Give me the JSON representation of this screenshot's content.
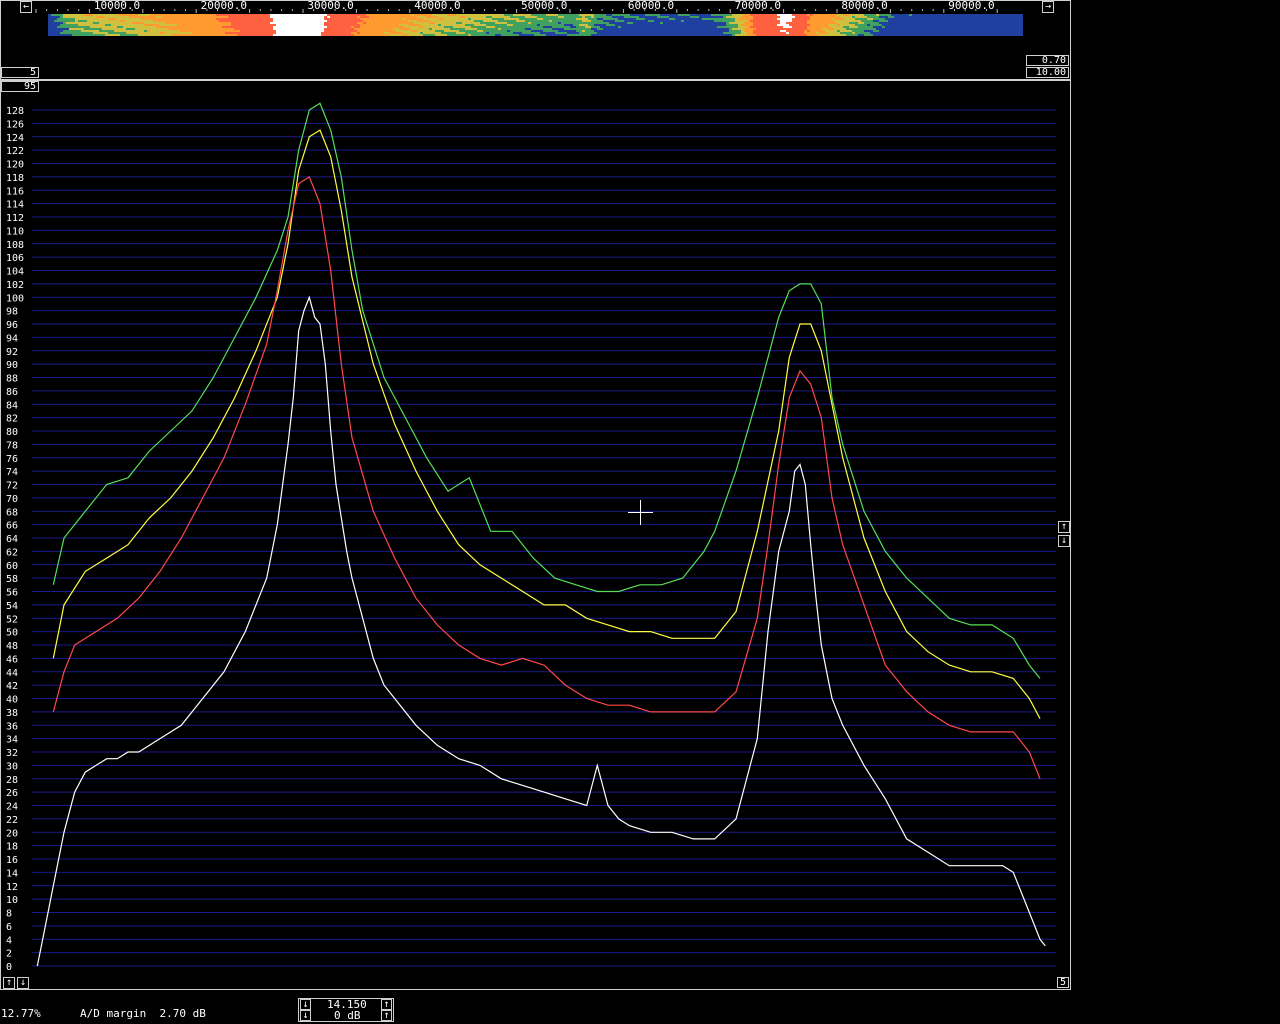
{
  "freq_axis": {
    "labels": [
      "10000.0",
      "20000.0",
      "30000.0",
      "40000.0",
      "50000.0",
      "60000.0",
      "70000.0",
      "80000.0",
      "90000.0"
    ]
  },
  "left_boxes": {
    "box_a": "5",
    "box_b": "95"
  },
  "right_boxes": {
    "box_a": "0.70",
    "box_b": "10.00"
  },
  "bottom_right_box": "5",
  "y_axis": {
    "min": 0,
    "max": 128,
    "step": 2,
    "labels": [
      "128",
      "126",
      "124",
      "122",
      "120",
      "118",
      "116",
      "114",
      "112",
      "110",
      "108",
      "106",
      "104",
      "102",
      "100",
      "98",
      "96",
      "94",
      "92",
      "90",
      "88",
      "86",
      "84",
      "82",
      "80",
      "78",
      "76",
      "74",
      "72",
      "70",
      "68",
      "66",
      "64",
      "62",
      "60",
      "58",
      "56",
      "54",
      "52",
      "50",
      "48",
      "46",
      "44",
      "42",
      "40",
      "38",
      "36",
      "34",
      "32",
      "30",
      "28",
      "26",
      "24",
      "22",
      "20",
      "18",
      "16",
      "14",
      "12",
      "10",
      "8",
      "6",
      "4",
      "2",
      "0"
    ]
  },
  "colors": {
    "grid": "#1a1a8c",
    "trace_white": "#ffffff",
    "trace_red": "#ff4a4a",
    "trace_yellow": "#ffff40",
    "trace_green": "#55e055",
    "frame": "#cfcfcf"
  },
  "chart_data": {
    "type": "line",
    "xlabel": "",
    "ylabel": "",
    "xlim": [
      0,
      96000
    ],
    "ylim": [
      0,
      128
    ],
    "series": [
      {
        "color": "green",
        "x": [
          2000,
          3000,
          5000,
          7000,
          9000,
          11000,
          13000,
          15000,
          17000,
          19000,
          21000,
          23000,
          24000,
          25000,
          26000,
          27000,
          28000,
          29000,
          30000,
          31000,
          33000,
          35000,
          37000,
          39000,
          41000,
          43000,
          45000,
          47000,
          49000,
          51000,
          53000,
          55000,
          57000,
          59000,
          61000,
          63000,
          64000,
          66000,
          68000,
          70000,
          71000,
          72000,
          73000,
          74000,
          75000,
          76000,
          77000,
          78000,
          80000,
          82000,
          84000,
          86000,
          88000,
          90000,
          92000,
          93500,
          94500
        ],
        "y": [
          57,
          64,
          68,
          72,
          73,
          77,
          80,
          83,
          88,
          94,
          100,
          107,
          112,
          122,
          128,
          129,
          125,
          118,
          107,
          98,
          88,
          82,
          76,
          71,
          73,
          65,
          65,
          61,
          58,
          57,
          56,
          56,
          57,
          57,
          58,
          62,
          65,
          74,
          85,
          97,
          101,
          102,
          102,
          99,
          85,
          78,
          73,
          68,
          62,
          58,
          55,
          52,
          51,
          51,
          49,
          45,
          43
        ]
      },
      {
        "color": "yellow",
        "x": [
          2000,
          3000,
          5000,
          7000,
          9000,
          11000,
          13000,
          15000,
          17000,
          19000,
          21000,
          23000,
          24000,
          25000,
          26000,
          27000,
          28000,
          29000,
          30000,
          32000,
          34000,
          36000,
          38000,
          40000,
          42000,
          44000,
          46000,
          48000,
          50000,
          52000,
          54000,
          56000,
          58000,
          60000,
          62000,
          64000,
          66000,
          68000,
          70000,
          71000,
          72000,
          73000,
          74000,
          75000,
          76000,
          78000,
          80000,
          82000,
          84000,
          86000,
          88000,
          90000,
          92000,
          93500,
          94500
        ],
        "y": [
          46,
          54,
          59,
          61,
          63,
          67,
          70,
          74,
          79,
          85,
          92,
          100,
          108,
          119,
          124,
          125,
          121,
          113,
          103,
          90,
          81,
          74,
          68,
          63,
          60,
          58,
          56,
          54,
          54,
          52,
          51,
          50,
          50,
          49,
          49,
          49,
          53,
          65,
          80,
          91,
          96,
          96,
          92,
          84,
          76,
          64,
          56,
          50,
          47,
          45,
          44,
          44,
          43,
          40,
          37
        ]
      },
      {
        "color": "red",
        "x": [
          2000,
          3000,
          4000,
          6000,
          8000,
          10000,
          12000,
          14000,
          16000,
          18000,
          20000,
          22000,
          23000,
          24000,
          25000,
          26000,
          27000,
          28000,
          29000,
          30000,
          32000,
          34000,
          36000,
          38000,
          40000,
          42000,
          44000,
          46000,
          48000,
          50000,
          52000,
          54000,
          56000,
          58000,
          60000,
          62000,
          64000,
          66000,
          68000,
          69000,
          70000,
          71000,
          72000,
          73000,
          74000,
          75000,
          76000,
          78000,
          80000,
          82000,
          84000,
          86000,
          88000,
          90000,
          92000,
          93500,
          94500
        ],
        "y": [
          38,
          44,
          48,
          50,
          52,
          55,
          59,
          64,
          70,
          76,
          84,
          93,
          101,
          110,
          117,
          118,
          114,
          104,
          90,
          79,
          68,
          61,
          55,
          51,
          48,
          46,
          45,
          46,
          45,
          42,
          40,
          39,
          39,
          38,
          38,
          38,
          38,
          41,
          52,
          63,
          75,
          85,
          89,
          87,
          82,
          70,
          63,
          54,
          45,
          41,
          38,
          36,
          35,
          35,
          35,
          32,
          28
        ]
      },
      {
        "color": "white",
        "x": [
          500,
          1000,
          2000,
          3000,
          4000,
          5000,
          6000,
          7000,
          8000,
          9000,
          10000,
          12000,
          14000,
          16000,
          18000,
          20000,
          22000,
          23000,
          24000,
          24500,
          25000,
          25500,
          26000,
          26500,
          27000,
          27500,
          28000,
          28500,
          29000,
          29500,
          30000,
          31000,
          32000,
          33000,
          34000,
          36000,
          38000,
          40000,
          42000,
          44000,
          46000,
          48000,
          50000,
          52000,
          53000,
          54000,
          55000,
          56000,
          58000,
          60000,
          62000,
          64000,
          66000,
          68000,
          69000,
          70000,
          71000,
          71500,
          72000,
          72500,
          73000,
          73500,
          74000,
          75000,
          76000,
          78000,
          80000,
          82000,
          84000,
          86000,
          88000,
          90000,
          91000,
          92000,
          93000,
          94000,
          94500,
          95000
        ],
        "y": [
          0,
          4,
          12,
          20,
          26,
          29,
          30,
          31,
          31,
          32,
          32,
          34,
          36,
          40,
          44,
          50,
          58,
          66,
          78,
          85,
          95,
          98,
          100,
          97,
          96,
          90,
          80,
          72,
          67,
          62,
          58,
          52,
          46,
          42,
          40,
          36,
          33,
          31,
          30,
          28,
          27,
          26,
          25,
          24,
          30,
          24,
          22,
          21,
          20,
          20,
          19,
          19,
          22,
          34,
          50,
          62,
          68,
          74,
          75,
          72,
          63,
          55,
          48,
          40,
          36,
          30,
          25,
          19,
          17,
          15,
          15,
          15,
          15,
          14,
          10,
          6,
          4,
          3
        ]
      }
    ]
  },
  "status_bar": {
    "percent": "12.77%",
    "ad_margin": "A/D margin  2.70 dB",
    "value_top": "14.150",
    "value_bottom": "0 dB"
  },
  "icons": {
    "left_arrow": "←",
    "right_arrow": "→",
    "up_arrow": "↑",
    "down_arrow": "↓"
  }
}
